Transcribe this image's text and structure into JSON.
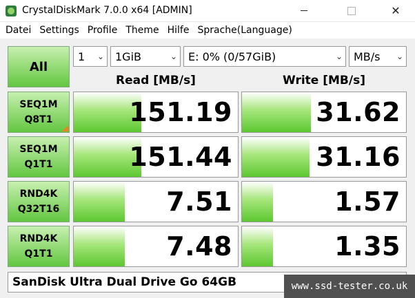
{
  "window": {
    "title": "CrystalDiskMark 7.0.0 x64 [ADMIN]",
    "minimize": "—",
    "maximize": "☐",
    "close": "✕"
  },
  "menu": [
    "Datei",
    "Settings",
    "Profile",
    "Theme",
    "Hilfe",
    "Sprache(Language)"
  ],
  "controls": {
    "all_button": "All",
    "count": "1",
    "size": "1GiB",
    "drive": "E: 0% (0/57GiB)",
    "unit": "MB/s"
  },
  "headers": {
    "read": "Read [MB/s]",
    "write": "Write [MB/s]"
  },
  "tests": [
    {
      "line1": "SEQ1M",
      "line2": "Q8T1",
      "read": "151.19",
      "write": "31.62",
      "read_fill": 0.41,
      "write_fill": 0.42
    },
    {
      "line1": "SEQ1M",
      "line2": "Q1T1",
      "read": "151.44",
      "write": "31.16",
      "read_fill": 0.41,
      "write_fill": 0.41
    },
    {
      "line1": "RND4K",
      "line2": "Q32T16",
      "read": "7.51",
      "write": "1.57",
      "read_fill": 0.31,
      "write_fill": 0.19
    },
    {
      "line1": "RND4K",
      "line2": "Q1T1",
      "read": "7.48",
      "write": "1.35",
      "read_fill": 0.31,
      "write_fill": 0.19
    }
  ],
  "footer": {
    "comment": "SanDisk Ultra Dual Drive Go 64GB"
  },
  "watermark": "www.ssd-tester.co.uk",
  "colors": {
    "bar_green": "#5cc830",
    "button_green": "#63c640",
    "accent_orange": "#f08020"
  }
}
